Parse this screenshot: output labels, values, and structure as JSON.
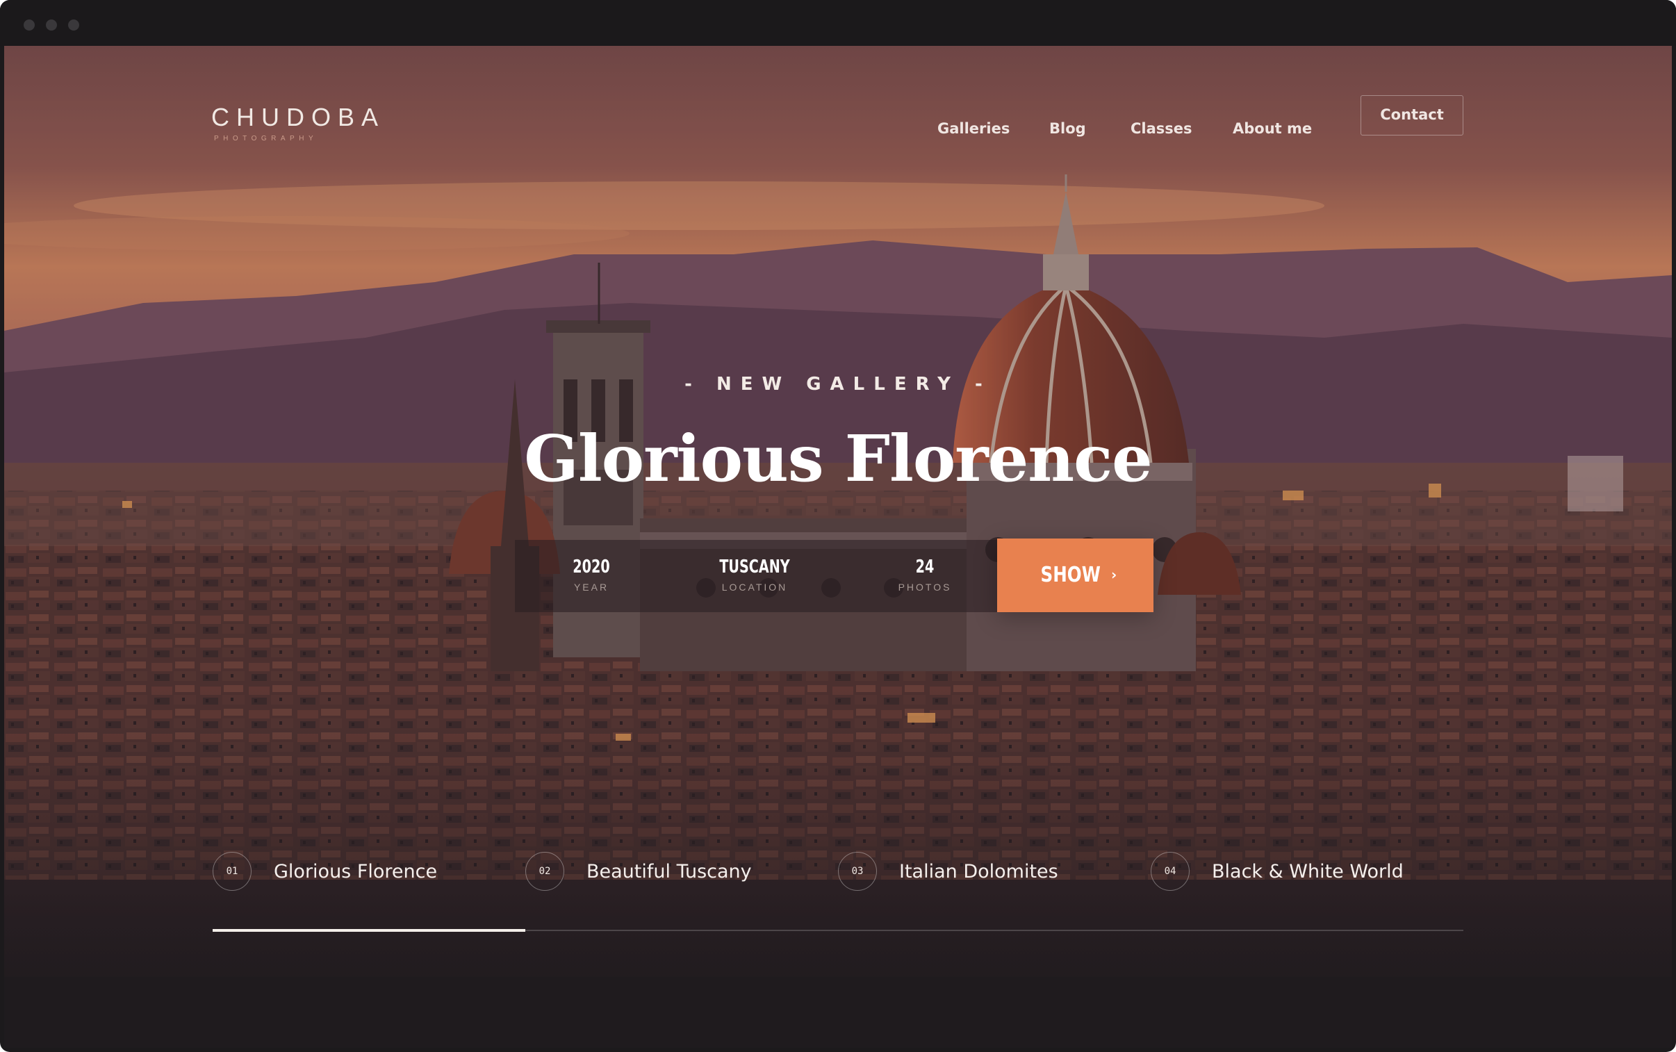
{
  "header": {
    "brand": "CHUDOBA",
    "brand_sub": "PHOTOGRAPHY",
    "nav": [
      {
        "label": "Galleries"
      },
      {
        "label": "Blog"
      },
      {
        "label": "Classes"
      },
      {
        "label": "About me"
      }
    ],
    "contact_label": "Contact"
  },
  "hero": {
    "eyebrow": "- NEW GALLERY -",
    "title": "Glorious Florence",
    "stats": [
      {
        "value": "2020",
        "label": "YEAR"
      },
      {
        "value": "TUSCANY",
        "label": "LOCATION"
      },
      {
        "value": "24",
        "label": "PHOTOS"
      }
    ],
    "show_label": "SHOW",
    "show_icon": "chevron-right-icon"
  },
  "slides": [
    {
      "num": "01",
      "label": "Glorious Florence"
    },
    {
      "num": "02",
      "label": "Beautiful Tuscany"
    },
    {
      "num": "03",
      "label": "Italian Dolomites"
    },
    {
      "num": "04",
      "label": "Black & White World"
    }
  ],
  "progress": {
    "active": 1,
    "total": 4,
    "fraction": 0.25
  },
  "colors": {
    "accent": "#e8814f",
    "sky_top": "#8a5b56",
    "sky_glow": "#e09368",
    "mountains": "#6a4a5c",
    "dome": "#8a4030",
    "window_frame": "#1b191b"
  }
}
